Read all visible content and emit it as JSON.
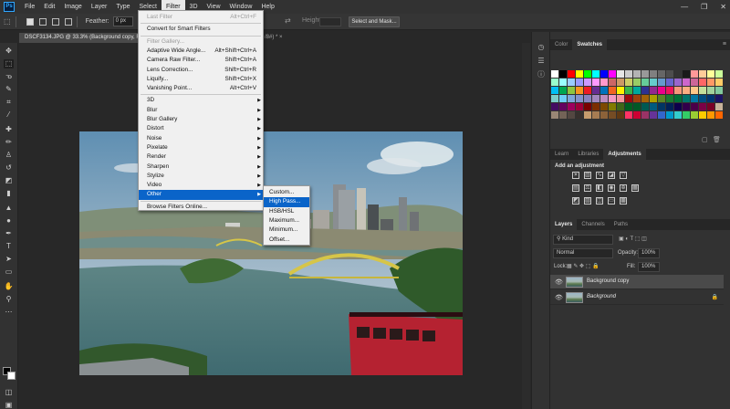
{
  "app": {
    "logo": "Ps",
    "menus": [
      "File",
      "Edit",
      "Image",
      "Layer",
      "Type",
      "Select",
      "Filter",
      "3D",
      "View",
      "Window",
      "Help"
    ],
    "active_menu": "Filter",
    "window_controls": [
      "—",
      "❐",
      "✕"
    ]
  },
  "options_bar": {
    "feather_label": "Feather:",
    "feather_value": "0 px",
    "height_label": "Height:",
    "select_and_mask": "Select and Mask..."
  },
  "document": {
    "tab_title": "DSCF3134.JPG @ 33.3% (Background copy, RGB/8#) *",
    "tab_title_tail": "/8#) *",
    "close": "×"
  },
  "filter_menu": {
    "items": [
      {
        "label": "Last Filter",
        "shortcut": "Alt+Ctrl+F",
        "disabled": true
      },
      {
        "label": "Convert for Smart Filters",
        "shortcut": ""
      },
      {
        "label": "Filter Gallery...",
        "shortcut": "",
        "disabled": true
      },
      {
        "label": "Adaptive Wide Angle...",
        "shortcut": "Alt+Shift+Ctrl+A"
      },
      {
        "label": "Camera Raw Filter...",
        "shortcut": "Shift+Ctrl+A"
      },
      {
        "label": "Lens Correction...",
        "shortcut": "Shift+Ctrl+R"
      },
      {
        "label": "Liquify...",
        "shortcut": "Shift+Ctrl+X"
      },
      {
        "label": "Vanishing Point...",
        "shortcut": "Alt+Ctrl+V"
      },
      {
        "label": "3D",
        "submenu": true
      },
      {
        "label": "Blur",
        "submenu": true
      },
      {
        "label": "Blur Gallery",
        "submenu": true
      },
      {
        "label": "Distort",
        "submenu": true
      },
      {
        "label": "Noise",
        "submenu": true
      },
      {
        "label": "Pixelate",
        "submenu": true
      },
      {
        "label": "Render",
        "submenu": true
      },
      {
        "label": "Sharpen",
        "submenu": true
      },
      {
        "label": "Stylize",
        "submenu": true
      },
      {
        "label": "Video",
        "submenu": true
      },
      {
        "label": "Other",
        "submenu": true,
        "highlighted": true
      },
      {
        "label": "Browse Filters Online...",
        "shortcut": ""
      }
    ]
  },
  "other_submenu": {
    "items": [
      {
        "label": "Custom..."
      },
      {
        "label": "High Pass...",
        "highlighted": true
      },
      {
        "label": "HSB/HSL"
      },
      {
        "label": "Maximum..."
      },
      {
        "label": "Minimum..."
      },
      {
        "label": "Offset..."
      }
    ]
  },
  "swatches_panel": {
    "tabs": [
      "Color",
      "Swatches"
    ],
    "active_tab": "Swatches",
    "menu_icon": "≡"
  },
  "adjustments_panel": {
    "tabs": [
      "Learn",
      "Libraries",
      "Adjustments"
    ],
    "active_tab": "Adjustments",
    "title": "Add an adjustment"
  },
  "layers_panel": {
    "tabs": [
      "Layers",
      "Channels",
      "Paths"
    ],
    "active_tab": "Layers",
    "kind_filter": "Kind",
    "blend_mode": "Normal",
    "opacity_label": "Opacity:",
    "opacity_value": "100%",
    "lock_label": "Lock:",
    "fill_label": "Fill:",
    "fill_value": "100%",
    "layers": [
      {
        "name": "Background copy",
        "selected": true,
        "locked": false
      },
      {
        "name": "Background",
        "selected": false,
        "locked": true
      }
    ]
  },
  "colors": {
    "menu_highlight": "#0a64c9",
    "app_bg": "#282828",
    "panel_bg": "#323232"
  }
}
